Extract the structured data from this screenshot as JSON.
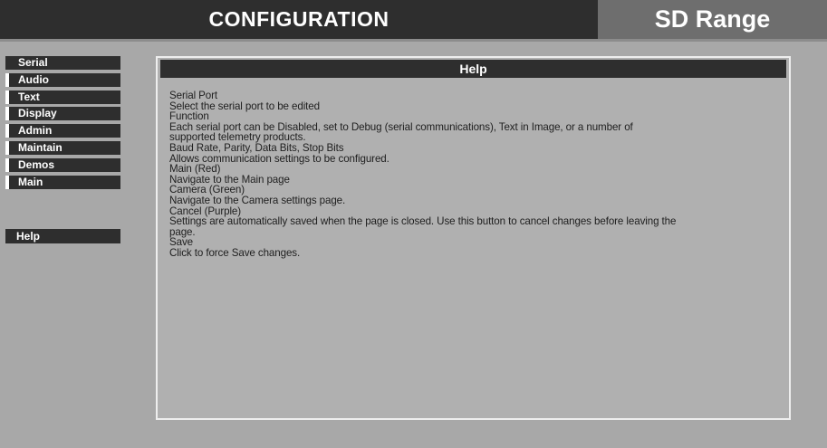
{
  "header": {
    "title": "CONFIGURATION",
    "brand": "SD Range"
  },
  "sidebar": {
    "items": [
      {
        "label": "Serial"
      },
      {
        "label": "Audio"
      },
      {
        "label": "Text"
      },
      {
        "label": "Display"
      },
      {
        "label": "Admin"
      },
      {
        "label": "Maintain"
      },
      {
        "label": "Demos"
      },
      {
        "label": "Main"
      }
    ],
    "help_label": "Help"
  },
  "help": {
    "title": "Help",
    "lines": [
      "Serial Port",
      "Select the serial port to be edited",
      "Function",
      "Each serial port can be Disabled, set to Debug (serial communications), Text in Image, or a number of",
      "supported telemetry products.",
      "Baud Rate, Parity, Data Bits, Stop Bits",
      "Allows communication settings to be configured.",
      "Main (Red)",
      "Navigate to the Main page",
      "Camera (Green)",
      "Navigate to the Camera settings page.",
      "Cancel (Purple)",
      "Settings are automatically saved when the page is closed. Use this button to cancel changes before leaving the",
      "page.",
      "Save",
      "Click to force Save changes."
    ]
  },
  "colors": {
    "background": "#a8a8a8",
    "bar": "#2e2e2e",
    "brand_bg": "#6e6e6e",
    "text": "#202020"
  }
}
